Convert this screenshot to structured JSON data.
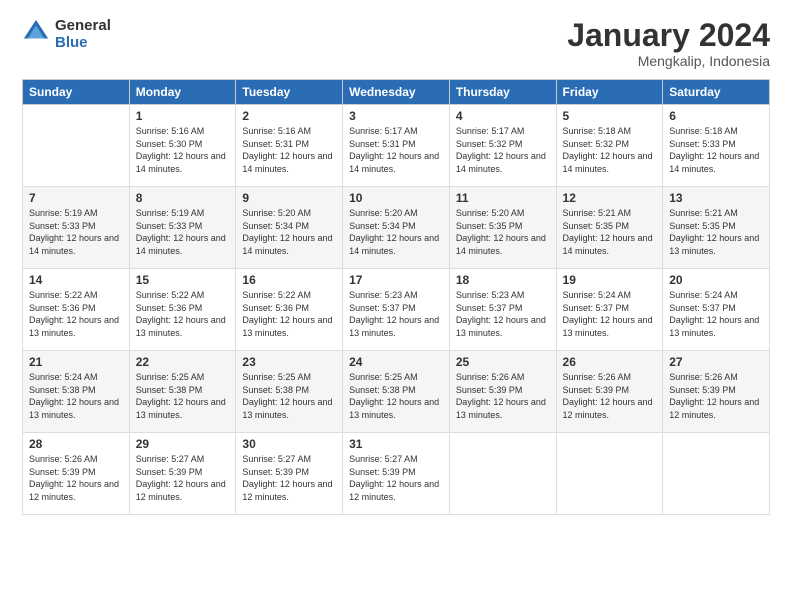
{
  "logo": {
    "general": "General",
    "blue": "Blue"
  },
  "title": "January 2024",
  "location": "Mengkalip, Indonesia",
  "headers": [
    "Sunday",
    "Monday",
    "Tuesday",
    "Wednesday",
    "Thursday",
    "Friday",
    "Saturday"
  ],
  "weeks": [
    [
      {
        "day": "",
        "sunrise": "",
        "sunset": "",
        "daylight": ""
      },
      {
        "day": "1",
        "sunrise": "Sunrise: 5:16 AM",
        "sunset": "Sunset: 5:30 PM",
        "daylight": "Daylight: 12 hours and 14 minutes."
      },
      {
        "day": "2",
        "sunrise": "Sunrise: 5:16 AM",
        "sunset": "Sunset: 5:31 PM",
        "daylight": "Daylight: 12 hours and 14 minutes."
      },
      {
        "day": "3",
        "sunrise": "Sunrise: 5:17 AM",
        "sunset": "Sunset: 5:31 PM",
        "daylight": "Daylight: 12 hours and 14 minutes."
      },
      {
        "day": "4",
        "sunrise": "Sunrise: 5:17 AM",
        "sunset": "Sunset: 5:32 PM",
        "daylight": "Daylight: 12 hours and 14 minutes."
      },
      {
        "day": "5",
        "sunrise": "Sunrise: 5:18 AM",
        "sunset": "Sunset: 5:32 PM",
        "daylight": "Daylight: 12 hours and 14 minutes."
      },
      {
        "day": "6",
        "sunrise": "Sunrise: 5:18 AM",
        "sunset": "Sunset: 5:33 PM",
        "daylight": "Daylight: 12 hours and 14 minutes."
      }
    ],
    [
      {
        "day": "7",
        "sunrise": "Sunrise: 5:19 AM",
        "sunset": "Sunset: 5:33 PM",
        "daylight": "Daylight: 12 hours and 14 minutes."
      },
      {
        "day": "8",
        "sunrise": "Sunrise: 5:19 AM",
        "sunset": "Sunset: 5:33 PM",
        "daylight": "Daylight: 12 hours and 14 minutes."
      },
      {
        "day": "9",
        "sunrise": "Sunrise: 5:20 AM",
        "sunset": "Sunset: 5:34 PM",
        "daylight": "Daylight: 12 hours and 14 minutes."
      },
      {
        "day": "10",
        "sunrise": "Sunrise: 5:20 AM",
        "sunset": "Sunset: 5:34 PM",
        "daylight": "Daylight: 12 hours and 14 minutes."
      },
      {
        "day": "11",
        "sunrise": "Sunrise: 5:20 AM",
        "sunset": "Sunset: 5:35 PM",
        "daylight": "Daylight: 12 hours and 14 minutes."
      },
      {
        "day": "12",
        "sunrise": "Sunrise: 5:21 AM",
        "sunset": "Sunset: 5:35 PM",
        "daylight": "Daylight: 12 hours and 14 minutes."
      },
      {
        "day": "13",
        "sunrise": "Sunrise: 5:21 AM",
        "sunset": "Sunset: 5:35 PM",
        "daylight": "Daylight: 12 hours and 13 minutes."
      }
    ],
    [
      {
        "day": "14",
        "sunrise": "Sunrise: 5:22 AM",
        "sunset": "Sunset: 5:36 PM",
        "daylight": "Daylight: 12 hours and 13 minutes."
      },
      {
        "day": "15",
        "sunrise": "Sunrise: 5:22 AM",
        "sunset": "Sunset: 5:36 PM",
        "daylight": "Daylight: 12 hours and 13 minutes."
      },
      {
        "day": "16",
        "sunrise": "Sunrise: 5:22 AM",
        "sunset": "Sunset: 5:36 PM",
        "daylight": "Daylight: 12 hours and 13 minutes."
      },
      {
        "day": "17",
        "sunrise": "Sunrise: 5:23 AM",
        "sunset": "Sunset: 5:37 PM",
        "daylight": "Daylight: 12 hours and 13 minutes."
      },
      {
        "day": "18",
        "sunrise": "Sunrise: 5:23 AM",
        "sunset": "Sunset: 5:37 PM",
        "daylight": "Daylight: 12 hours and 13 minutes."
      },
      {
        "day": "19",
        "sunrise": "Sunrise: 5:24 AM",
        "sunset": "Sunset: 5:37 PM",
        "daylight": "Daylight: 12 hours and 13 minutes."
      },
      {
        "day": "20",
        "sunrise": "Sunrise: 5:24 AM",
        "sunset": "Sunset: 5:37 PM",
        "daylight": "Daylight: 12 hours and 13 minutes."
      }
    ],
    [
      {
        "day": "21",
        "sunrise": "Sunrise: 5:24 AM",
        "sunset": "Sunset: 5:38 PM",
        "daylight": "Daylight: 12 hours and 13 minutes."
      },
      {
        "day": "22",
        "sunrise": "Sunrise: 5:25 AM",
        "sunset": "Sunset: 5:38 PM",
        "daylight": "Daylight: 12 hours and 13 minutes."
      },
      {
        "day": "23",
        "sunrise": "Sunrise: 5:25 AM",
        "sunset": "Sunset: 5:38 PM",
        "daylight": "Daylight: 12 hours and 13 minutes."
      },
      {
        "day": "24",
        "sunrise": "Sunrise: 5:25 AM",
        "sunset": "Sunset: 5:38 PM",
        "daylight": "Daylight: 12 hours and 13 minutes."
      },
      {
        "day": "25",
        "sunrise": "Sunrise: 5:26 AM",
        "sunset": "Sunset: 5:39 PM",
        "daylight": "Daylight: 12 hours and 13 minutes."
      },
      {
        "day": "26",
        "sunrise": "Sunrise: 5:26 AM",
        "sunset": "Sunset: 5:39 PM",
        "daylight": "Daylight: 12 hours and 12 minutes."
      },
      {
        "day": "27",
        "sunrise": "Sunrise: 5:26 AM",
        "sunset": "Sunset: 5:39 PM",
        "daylight": "Daylight: 12 hours and 12 minutes."
      }
    ],
    [
      {
        "day": "28",
        "sunrise": "Sunrise: 5:26 AM",
        "sunset": "Sunset: 5:39 PM",
        "daylight": "Daylight: 12 hours and 12 minutes."
      },
      {
        "day": "29",
        "sunrise": "Sunrise: 5:27 AM",
        "sunset": "Sunset: 5:39 PM",
        "daylight": "Daylight: 12 hours and 12 minutes."
      },
      {
        "day": "30",
        "sunrise": "Sunrise: 5:27 AM",
        "sunset": "Sunset: 5:39 PM",
        "daylight": "Daylight: 12 hours and 12 minutes."
      },
      {
        "day": "31",
        "sunrise": "Sunrise: 5:27 AM",
        "sunset": "Sunset: 5:39 PM",
        "daylight": "Daylight: 12 hours and 12 minutes."
      },
      {
        "day": "",
        "sunrise": "",
        "sunset": "",
        "daylight": ""
      },
      {
        "day": "",
        "sunrise": "",
        "sunset": "",
        "daylight": ""
      },
      {
        "day": "",
        "sunrise": "",
        "sunset": "",
        "daylight": ""
      }
    ]
  ]
}
